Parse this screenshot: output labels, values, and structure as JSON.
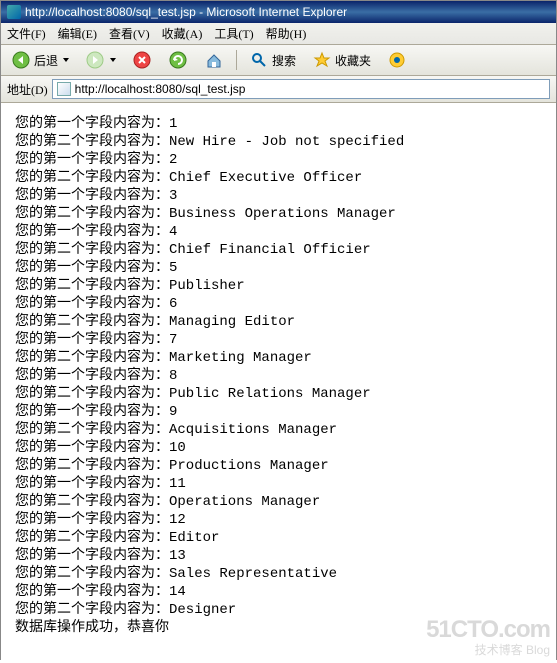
{
  "window": {
    "title": "http://localhost:8080/sql_test.jsp - Microsoft Internet Explorer"
  },
  "menu": {
    "file": "文件(F)",
    "edit": "编辑(E)",
    "view": "查看(V)",
    "favorites": "收藏(A)",
    "tools": "工具(T)",
    "help": "帮助(H)"
  },
  "toolbar": {
    "back": "后退",
    "search": "搜索",
    "favorites": "收藏夹"
  },
  "address": {
    "label": "地址(D)",
    "url": "http://localhost:8080/sql_test.jsp"
  },
  "page": {
    "label1": "您的第一个字段内容为：",
    "label2": "您的第二个字段内容为：",
    "success": "数据库操作成功，恭喜你",
    "rows": [
      {
        "f1": "1",
        "f2": "New Hire - Job not specified"
      },
      {
        "f1": "2",
        "f2": "Chief Executive Officer"
      },
      {
        "f1": "3",
        "f2": "Business Operations Manager"
      },
      {
        "f1": "4",
        "f2": "Chief Financial Officier"
      },
      {
        "f1": "5",
        "f2": "Publisher"
      },
      {
        "f1": "6",
        "f2": "Managing Editor"
      },
      {
        "f1": "7",
        "f2": "Marketing Manager"
      },
      {
        "f1": "8",
        "f2": "Public Relations Manager"
      },
      {
        "f1": "9",
        "f2": "Acquisitions Manager"
      },
      {
        "f1": "10",
        "f2": "Productions Manager"
      },
      {
        "f1": "11",
        "f2": "Operations Manager"
      },
      {
        "f1": "12",
        "f2": "Editor"
      },
      {
        "f1": "13",
        "f2": "Sales Representative"
      },
      {
        "f1": "14",
        "f2": "Designer"
      }
    ]
  },
  "watermark": {
    "line1": "51CTO.com",
    "line2": "技术博客  Blog"
  }
}
